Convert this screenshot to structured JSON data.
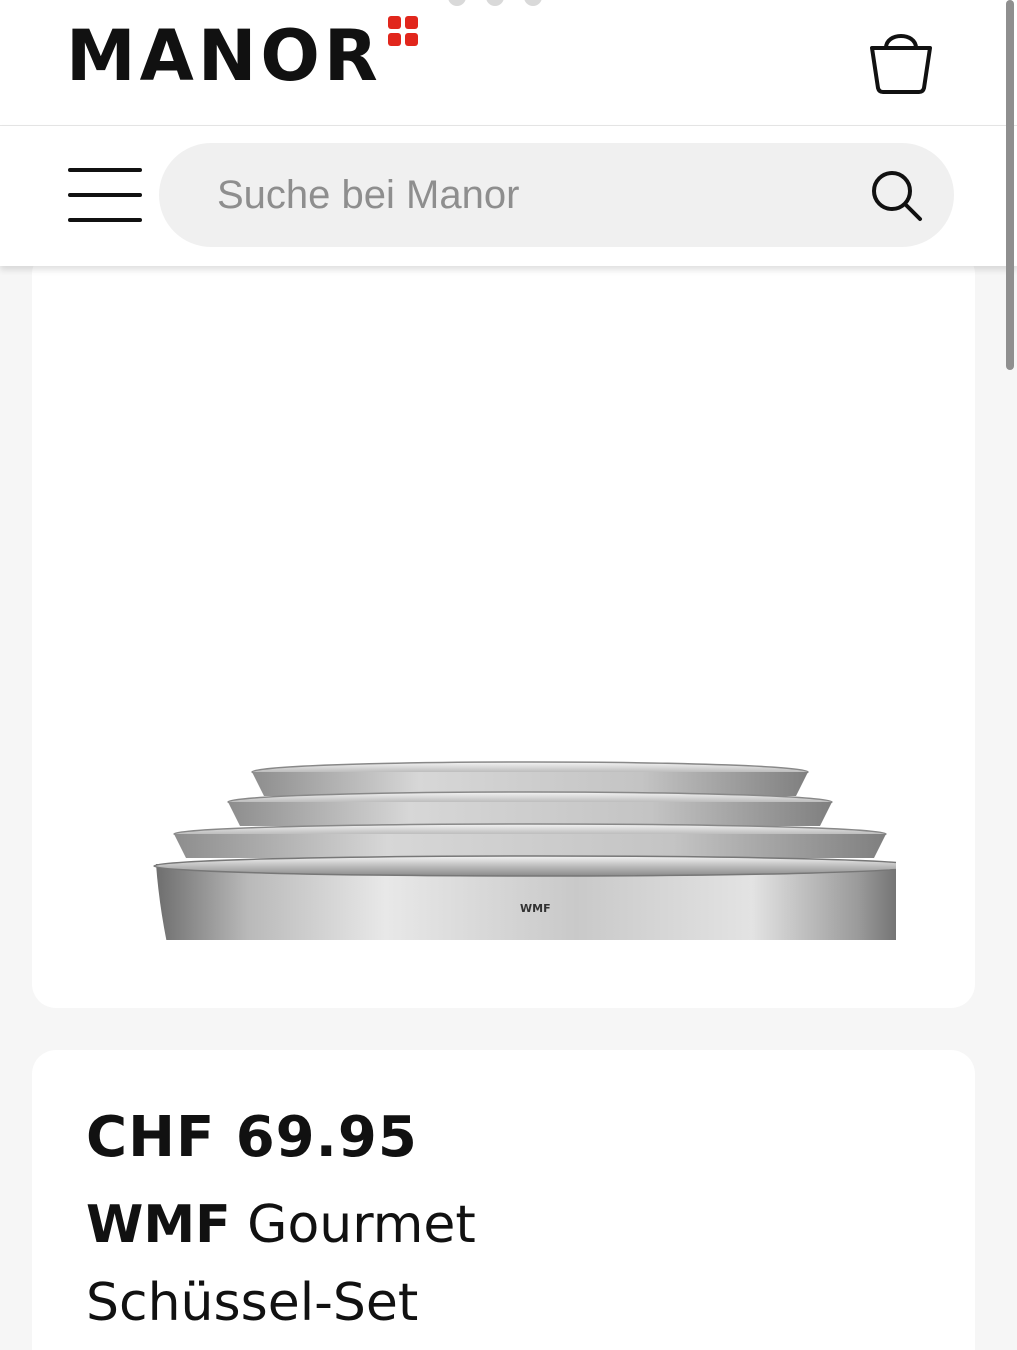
{
  "header": {
    "logo_text": "MANOR",
    "brand_color": "#e1261c",
    "cart_icon": "shopping-bag-icon"
  },
  "search": {
    "placeholder": "Suche bei Manor",
    "menu_icon": "hamburger-menu-icon",
    "search_icon": "search-icon"
  },
  "product": {
    "image_alt": "WMF Gourmet Schüssel-Set",
    "image_mark": "WMF",
    "price": "CHF 69.95",
    "brand": "WMF",
    "name_line1": "Gourmet",
    "name_line2": "Schüssel-Set"
  }
}
